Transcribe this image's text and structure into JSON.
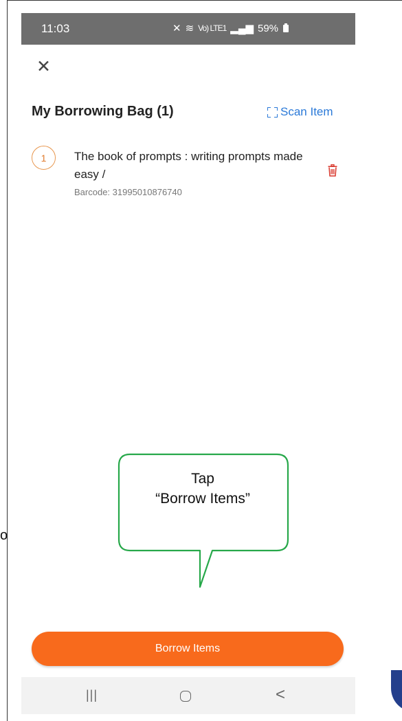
{
  "status_bar": {
    "time": "11:03",
    "network": "Vo) LTE1",
    "battery_percent": "59%"
  },
  "header": {
    "title": "My Borrowing Bag (1)",
    "scan_label": "Scan Item"
  },
  "bag_items": [
    {
      "number": "1",
      "title": "The book of prompts : writing prompts made easy /",
      "barcode": "Barcode: 31995010876740"
    }
  ],
  "annotation": {
    "text": "Tap\n“Borrow Items”"
  },
  "actions": {
    "borrow_label": "Borrow Items"
  },
  "nav": {
    "recent_glyph": "|||",
    "back_glyph": "<"
  },
  "edge": {
    "left_fragment": "o"
  },
  "colors": {
    "accent_orange": "#f86a1c",
    "link_blue": "#2a79d8",
    "delete_red": "#d9362b",
    "callout_green": "#27a84a"
  }
}
